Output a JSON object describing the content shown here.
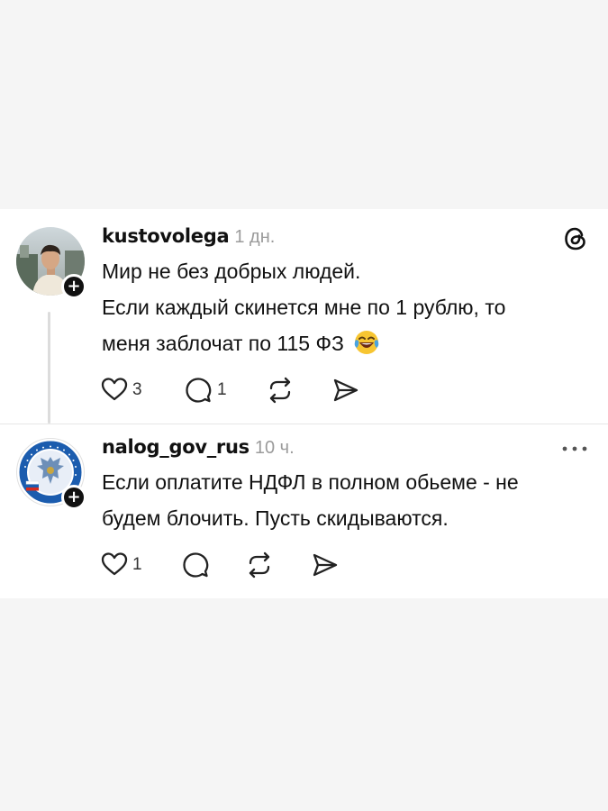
{
  "posts": [
    {
      "username": "kustovolega",
      "time": "1 дн.",
      "lines": [
        "Мир не без добрых людей.",
        "Если каждый скинется мне по 1 рублю, то",
        "меня заблочат по 115 ФЗ"
      ],
      "emoji": "😂",
      "like_count": "3",
      "reply_count": "1",
      "header_icon": "threads-logo-icon"
    },
    {
      "username": "nalog_gov_rus",
      "time": "10 ч.",
      "lines": [
        "Если оплатите НДФЛ в полном обьеме - не",
        "будем блочить. Пусть скидываются."
      ],
      "like_count": "1",
      "header_icon": "more-options-icon",
      "avatar_ring_text": "ФЕДЕРАЛЬНАЯ НАЛОГОВАЯ СЛУЖБА"
    }
  ],
  "colors": {
    "time_gray": "#9b9b9b",
    "divider": "#e6e6e6",
    "thread_line": "#dcdcdc",
    "fns_blue": "#1b5cae"
  }
}
